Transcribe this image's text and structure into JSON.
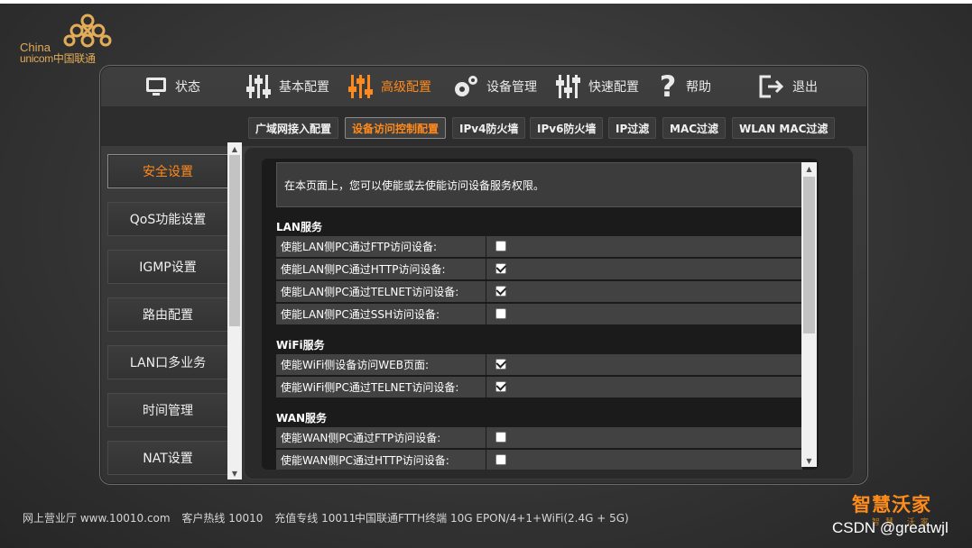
{
  "logo": {
    "line1": "China",
    "line2": "unicom中国联通"
  },
  "nav": [
    {
      "label": "状态",
      "icon": "monitor-icon"
    },
    {
      "label": "基本配置",
      "icon": "sliders-basic-icon"
    },
    {
      "label": "高级配置",
      "icon": "sliders-advanced-icon",
      "active": true
    },
    {
      "label": "设备管理",
      "icon": "gears-icon"
    },
    {
      "label": "快速配置",
      "icon": "sliders-quick-icon"
    },
    {
      "label": "帮助",
      "icon": "question-icon"
    },
    {
      "label": "退出",
      "icon": "logout-icon"
    }
  ],
  "subtabs": [
    "广域网接入配置",
    "设备访问控制配置",
    "IPv4防火墙",
    "IPv6防火墙",
    "IP过滤",
    "MAC过滤",
    "WLAN MAC过滤"
  ],
  "active_subtab": "设备访问控制配置",
  "leftmenu": [
    "安全设置",
    "QoS功能设置",
    "IGMP设置",
    "路由配置",
    "LAN口多业务",
    "时间管理",
    "NAT设置"
  ],
  "active_menu": "安全设置",
  "content": {
    "description": "在本页面上，您可以使能或去使能访问设备服务权限。",
    "sections": [
      {
        "title": "LAN服务",
        "rows": [
          {
            "label": "使能LAN侧PC通过FTP访问设备:",
            "checked": false
          },
          {
            "label": "使能LAN侧PC通过HTTP访问设备:",
            "checked": true
          },
          {
            "label": "使能LAN侧PC通过TELNET访问设备:",
            "checked": true
          },
          {
            "label": "使能LAN侧PC通过SSH访问设备:",
            "checked": false
          }
        ]
      },
      {
        "title": "WiFi服务",
        "rows": [
          {
            "label": "使能WiFi侧设备访问WEB页面:",
            "checked": true
          },
          {
            "label": "使能WiFi侧PC通过TELNET访问设备:",
            "checked": true
          }
        ]
      },
      {
        "title": "WAN服务",
        "rows": [
          {
            "label": "使能WAN侧PC通过FTP访问设备:",
            "checked": false
          },
          {
            "label": "使能WAN侧PC通过HTTP访问设备:",
            "checked": false
          }
        ]
      }
    ]
  },
  "footer": {
    "hall": "网上营业厅 www.10010.com",
    "hotline": "客户热线 10010",
    "recharge": "充值专线 10011",
    "device": "中国联通FTTH终端 10G EPON/4+1+WiFi(2.4G + 5G)"
  },
  "brand": {
    "name": "智慧沃家",
    "sub": "智慧 沃家"
  },
  "watermark": "CSDN @greatwjl",
  "colors": {
    "accent": "#ff8a1c",
    "logo": "#e2ac58"
  }
}
